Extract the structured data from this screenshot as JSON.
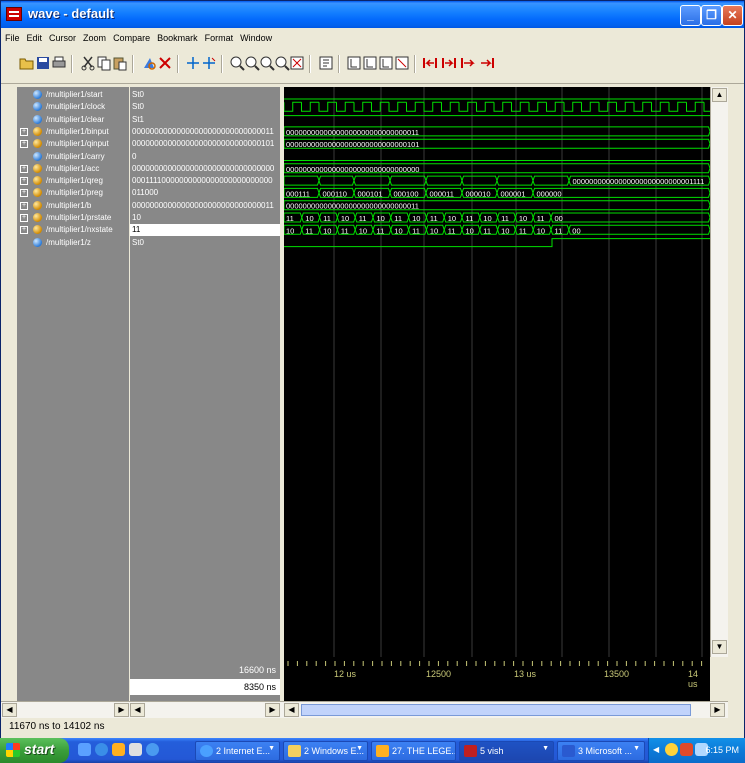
{
  "window": {
    "title": "wave - default"
  },
  "menu": [
    "File",
    "Edit",
    "Cursor",
    "Zoom",
    "Compare",
    "Bookmark",
    "Format",
    "Window"
  ],
  "toolbar_icons": [
    "open-icon",
    "save-icon",
    "print-icon",
    "cut-icon",
    "copy-icon",
    "paste-icon",
    "find-icon",
    "delete-icon",
    "cursor-add-icon",
    "cursor-delete-icon",
    "zoom-in-icon",
    "zoom-out-icon",
    "zoom-full-icon",
    "zoom-cursor-icon",
    "zoom-range-icon",
    "edit-format-icon",
    "dataflow-icon",
    "list-icon",
    "tree-icon",
    "memory-icon",
    "prev-edge-icon",
    "next-edge-icon",
    "prev-transition-icon",
    "next-transition-icon"
  ],
  "signals": [
    {
      "name": "/multiplier1/start",
      "value": "St0",
      "expandable": false,
      "bus": false
    },
    {
      "name": "/multiplier1/clock",
      "value": "St0",
      "expandable": false,
      "bus": false
    },
    {
      "name": "/multiplier1/clear",
      "value": "St1",
      "expandable": false,
      "bus": false
    },
    {
      "name": "/multiplier1/binput",
      "value": "00000000000000000000000000000011",
      "expandable": true,
      "bus": true
    },
    {
      "name": "/multiplier1/qinput",
      "value": "00000000000000000000000000000101",
      "expandable": true,
      "bus": true
    },
    {
      "name": "/multiplier1/carry",
      "value": "0",
      "expandable": false,
      "bus": false
    },
    {
      "name": "/multiplier1/acc",
      "value": "00000000000000000000000000000000",
      "expandable": true,
      "bus": true
    },
    {
      "name": "/multiplier1/qreg",
      "value": "00011110000000000000000000000000",
      "expandable": true,
      "bus": true
    },
    {
      "name": "/multiplier1/preg",
      "value": "011000",
      "expandable": true,
      "bus": true
    },
    {
      "name": "/multiplier1/b",
      "value": "00000000000000000000000000000011",
      "expandable": true,
      "bus": true
    },
    {
      "name": "/multiplier1/prstate",
      "value": "10",
      "expandable": true,
      "bus": true
    },
    {
      "name": "/multiplier1/nxstate",
      "value": "11",
      "expandable": true,
      "bus": true,
      "selected": true
    },
    {
      "name": "/multiplier1/z",
      "value": "St0",
      "expandable": false,
      "bus": false
    }
  ],
  "wave_labels": {
    "binput": "00000000000000000000000000000011",
    "qinput": "00000000000000000000000000000101",
    "acc": "00000000000000000000000000000000",
    "qreg_end": "00000000000000000000000000001111",
    "preg": [
      "000111",
      "000110",
      "000101",
      "000100",
      "000011",
      "000010",
      "000001",
      "000000"
    ],
    "b": "00000000000000000000000000000011",
    "prstate": [
      "11",
      "10",
      "11",
      "10",
      "11",
      "10",
      "11",
      "10",
      "11",
      "10",
      "11",
      "10",
      "11",
      "10",
      "11",
      "00"
    ],
    "nxstate": [
      "10",
      "11",
      "10",
      "11",
      "10",
      "11",
      "10",
      "11",
      "10",
      "11",
      "10",
      "11",
      "10",
      "11",
      "10",
      "11",
      "00"
    ]
  },
  "cursor": {
    "now": "16600 ns",
    "cursor1": "8350 ns"
  },
  "timeline": [
    "12 us",
    "12500",
    "13 us",
    "13500",
    "14 us"
  ],
  "status": "11670 ns to 14102 ns",
  "taskbar": {
    "start": "start",
    "tasks": [
      "2 Internet E...",
      "2 Windows E...",
      "27. THE LEGE...",
      "5 vish",
      "3 Microsoft ..."
    ],
    "clock": "6:15 PM"
  }
}
